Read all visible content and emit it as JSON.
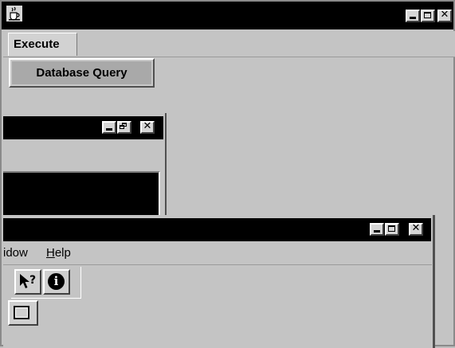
{
  "main_window": {
    "title_icon": "java-cup-icon",
    "controls": [
      "minimize-icon",
      "maximize-icon",
      "close-icon"
    ],
    "close_glyph": "✕"
  },
  "menubar": {
    "execute_label": "Execute"
  },
  "execute_menu": {
    "items": [
      {
        "label": "Database Query"
      }
    ]
  },
  "child_window_1": {
    "controls": [
      "minimize-icon",
      "restore-icon",
      "close-icon"
    ],
    "close_glyph": "✕"
  },
  "child_window_2": {
    "controls": [
      "minimize-icon",
      "maximize-icon",
      "close-icon"
    ],
    "close_glyph": "✕",
    "menu": {
      "window_label": "idow",
      "help_label": "Help"
    },
    "toolbar": {
      "context_help_icon": "context-help-icon",
      "info_icon": "info-icon",
      "info_glyph": "i"
    },
    "bottom_button_icon": "window-icon"
  },
  "colors": {
    "titlebar": "#000000",
    "background": "#c4c4c4",
    "highlight": "#a9a9a9"
  }
}
